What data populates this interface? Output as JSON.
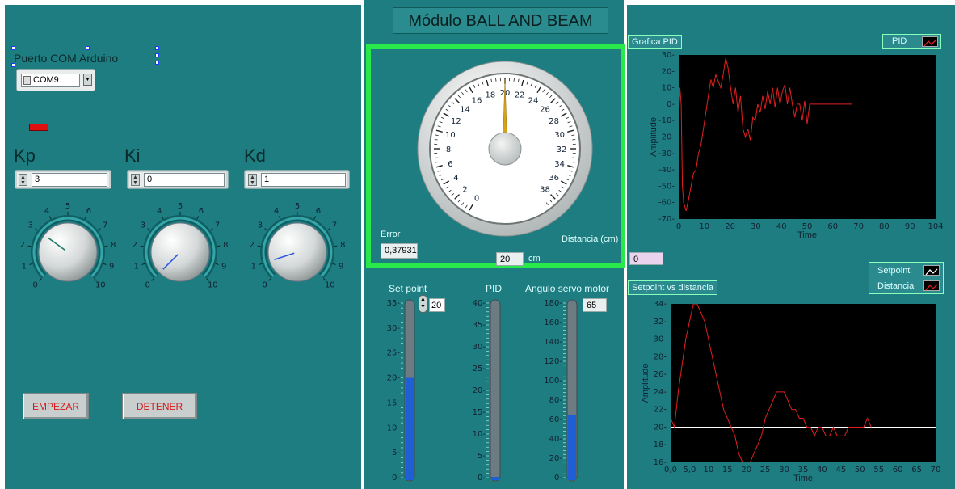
{
  "header": {
    "title": "Módulo BALL AND BEAM"
  },
  "left": {
    "com_label": "Puerto COM Arduino",
    "com_value": "COM9",
    "kp_label": "Kp",
    "ki_label": "Ki",
    "kd_label": "Kd",
    "kp_value": "3",
    "ki_value": "0",
    "kd_value": "1",
    "knob_scale": [
      "0",
      "1",
      "2",
      "3",
      "4",
      "5",
      "6",
      "7",
      "8",
      "9",
      "10"
    ],
    "kp_knob": 3,
    "ki_knob": 0,
    "kd_knob": 1,
    "start_label": "EMPEZAR",
    "stop_label": "DETENER",
    "led_color": "#e01010"
  },
  "gauge": {
    "scale": [
      "0",
      "2",
      "4",
      "6",
      "8",
      "10",
      "12",
      "14",
      "16",
      "18",
      "20",
      "22",
      "24",
      "26",
      "28",
      "30",
      "32",
      "34",
      "36",
      "38"
    ],
    "value": 20,
    "distance_label": "Distancia (cm)",
    "distance_value": "20",
    "distance_unit": "cm",
    "error_label": "Error",
    "error_value": "0,37931"
  },
  "sliders": {
    "setpoint_label": "Set point",
    "setpoint_value": "20",
    "setpoint_level": 20,
    "setpoint_scale": [
      "0",
      "5",
      "10",
      "15",
      "20",
      "25",
      "30",
      "35"
    ],
    "pid_label": "PID",
    "pid_level": 0,
    "pid_scale": [
      "0",
      "5",
      "10",
      "15",
      "20",
      "25",
      "30",
      "35",
      "40"
    ],
    "servo_label": "Angulo servo motor",
    "servo_value": "65",
    "servo_level": 65,
    "servo_scale": [
      "0",
      "20",
      "40",
      "60",
      "80",
      "100",
      "120",
      "140",
      "160",
      "180"
    ]
  },
  "charts": {
    "pid_caption": "Grafica PID",
    "pid_legend": "PID",
    "pid_xvalue": "0",
    "sp_caption": "Setpoint vs distancia",
    "sp_legend_setpoint": "Setpoint",
    "sp_legend_distance": "Distancia",
    "legend_color": "#e02020"
  },
  "chart_data": [
    {
      "type": "line",
      "title": "Grafica PID",
      "xlabel": "Time",
      "ylabel": "Amplitude",
      "xlim": [
        0,
        104
      ],
      "ylim": [
        -70,
        30
      ],
      "xticks": [
        "0",
        "10",
        "20",
        "30",
        "40",
        "50",
        "60",
        "70",
        "80",
        "90",
        "104"
      ],
      "yticks": [
        "30",
        "20",
        "10",
        "0",
        "-10",
        "-20",
        "-30",
        "-40",
        "-50",
        "-60",
        "-70"
      ],
      "series": [
        {
          "name": "PID",
          "color": "#e02020",
          "x": [
            0,
            0.5,
            1,
            1.5,
            2,
            3,
            4,
            5,
            6,
            7,
            8,
            9,
            10,
            11,
            12,
            13,
            14,
            15,
            16,
            17,
            18,
            19,
            20,
            21,
            22,
            23,
            24,
            25,
            26,
            27,
            28,
            29,
            30,
            31,
            32,
            33,
            34,
            35,
            36,
            37,
            38,
            39,
            40,
            41,
            42,
            43,
            44,
            45,
            46,
            47,
            48,
            49,
            50,
            51,
            52,
            53,
            54,
            55,
            70
          ],
          "y": [
            -10,
            10,
            0,
            -50,
            -60,
            -65,
            -58,
            -50,
            -42,
            -40,
            -30,
            -25,
            -15,
            -5,
            5,
            15,
            10,
            18,
            14,
            10,
            18,
            28,
            22,
            10,
            0,
            10,
            -5,
            5,
            -15,
            -20,
            -15,
            -22,
            -8,
            -10,
            0,
            -5,
            5,
            -3,
            8,
            0,
            10,
            -2,
            10,
            0,
            8,
            12,
            0,
            10,
            0,
            -8,
            0,
            0,
            -10,
            2,
            -12,
            0,
            0,
            0,
            0
          ]
        }
      ]
    },
    {
      "type": "line",
      "title": "Setpoint vs distancia",
      "xlabel": "Time",
      "ylabel": "Amplitude",
      "xlim": [
        0,
        70
      ],
      "ylim": [
        16,
        34
      ],
      "xticks": [
        "0,0",
        "5,0",
        "10",
        "15",
        "20",
        "25",
        "30",
        "35",
        "40",
        "45",
        "50",
        "55",
        "60",
        "65",
        "70"
      ],
      "yticks": [
        "34",
        "32",
        "30",
        "28",
        "26",
        "24",
        "22",
        "20",
        "18",
        "16"
      ],
      "series": [
        {
          "name": "Setpoint",
          "color": "#ffffff",
          "x": [
            0,
            70
          ],
          "y": [
            20,
            20
          ]
        },
        {
          "name": "Distancia",
          "color": "#e02020",
          "x": [
            0,
            1,
            2,
            3,
            4,
            5,
            6,
            7,
            8,
            9,
            10,
            11,
            12,
            13,
            14,
            15,
            16,
            17,
            18,
            19,
            20,
            21,
            22,
            23,
            24,
            25,
            26,
            27,
            28,
            29,
            30,
            31,
            32,
            33,
            34,
            35,
            36,
            37,
            38,
            39,
            40,
            41,
            42,
            43,
            44,
            45,
            46,
            47,
            48,
            49,
            50,
            51,
            52,
            53
          ],
          "y": [
            21,
            20,
            24,
            27,
            30,
            32,
            34,
            34,
            33,
            32,
            30,
            28,
            26,
            24,
            22,
            21,
            20,
            19,
            17,
            16,
            16,
            16,
            17,
            18,
            19,
            21,
            22,
            23,
            24,
            24,
            24,
            23,
            22,
            22,
            21,
            21,
            20,
            20,
            19,
            20,
            20,
            19,
            19,
            20,
            19,
            19,
            19,
            20,
            20,
            20,
            20,
            20,
            21,
            20
          ]
        }
      ]
    }
  ]
}
